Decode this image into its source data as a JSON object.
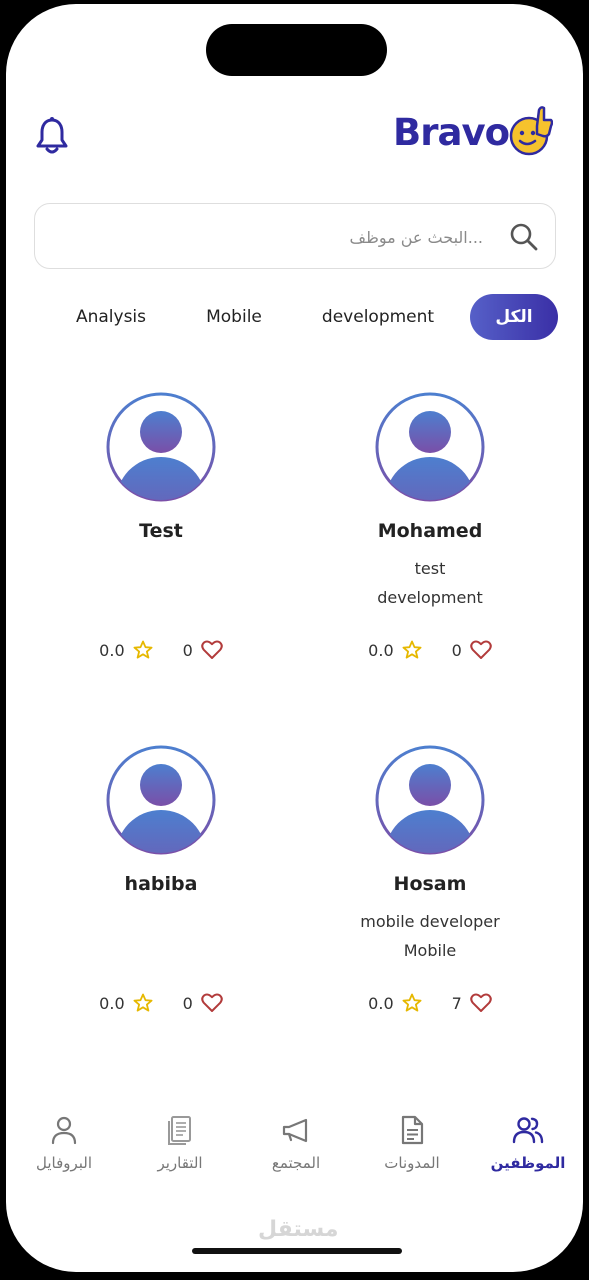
{
  "app": {
    "logo_text": "Bravo"
  },
  "search": {
    "placeholder": "...البحث عن موظف"
  },
  "filters": [
    {
      "label": "الكل",
      "active": true
    },
    {
      "label": "development",
      "active": false
    },
    {
      "label": "Mobile",
      "active": false
    },
    {
      "label": "Analysis",
      "active": false
    }
  ],
  "employees": [
    {
      "name": "Mohamed",
      "role_line1": "test",
      "role_line2": "development",
      "likes": "0",
      "rating": "0.0"
    },
    {
      "name": "Test",
      "role_line1": "",
      "role_line2": "",
      "likes": "0",
      "rating": "0.0"
    },
    {
      "name": "Hosam",
      "role_line1": "mobile developer",
      "role_line2": "Mobile",
      "likes": "7",
      "rating": "0.0"
    },
    {
      "name": "habiba",
      "role_line1": "",
      "role_line2": "",
      "likes": "0",
      "rating": "0.0"
    }
  ],
  "nav": [
    {
      "label": "الموظفين",
      "icon": "users-icon",
      "active": true
    },
    {
      "label": "المدونات",
      "icon": "document-icon",
      "active": false
    },
    {
      "label": "المجتمع",
      "icon": "megaphone-icon",
      "active": false
    },
    {
      "label": "التقارير",
      "icon": "reports-icon",
      "active": false
    },
    {
      "label": "البروفايل",
      "icon": "user-icon",
      "active": false
    }
  ],
  "watermark": "مستقل",
  "colors": {
    "primary": "#2f2aa0",
    "heart": "#b23b3b",
    "star": "#e6b800"
  }
}
